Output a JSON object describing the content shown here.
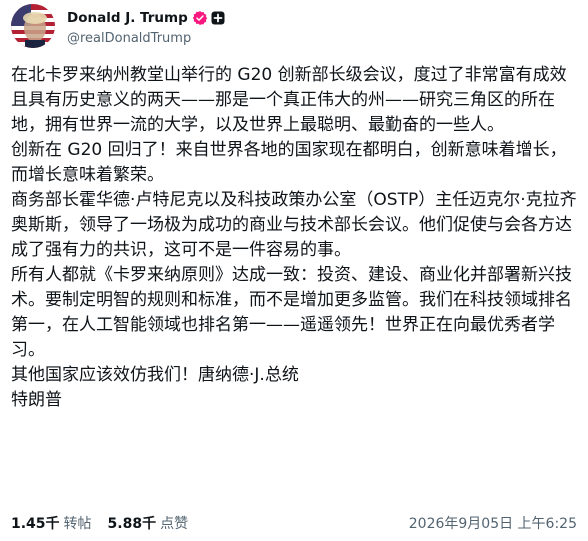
{
  "author": {
    "display_name": "Donald J. Trump",
    "handle": "@realDonaldTrump",
    "verified_color": "#f91880"
  },
  "post": {
    "paragraphs": [
      "在北卡罗来纳州教堂山举行的 G20 创新部长级会议，度过了非常富有成效且具有历史意义的两天——那是一个真正伟大的州——研究三角区的所在地，拥有世界一流的大学，以及世界上最聪明、最勤奋的一些人。",
      "创新在 G20 回归了！来自世界各地的国家现在都明白，创新意味着增长，而增长意味着繁荣。",
      "商务部长霍华德·卢特尼克以及科技政策办公室（OSTP）主任迈克尔·克拉齐奥斯斯，领导了一场极为成功的商业与技术部长会议。他们促使与会各方达成了强有力的共识，这可不是一件容易的事。",
      "所有人都就《卡罗来纳原则》达成一致：投资、建设、商业化并部署新兴技术。要制定明智的规则和标准，而不是增加更多监管。我们在科技领域排名第一，在人工智能领域也排名第一——遥遥领先！世界正在向最优秀者学习。",
      "其他国家应该效仿我们！唐纳德·J.总统",
      "特朗普"
    ]
  },
  "stats": {
    "reposts_count": "1.45千",
    "reposts_label": "转帖",
    "likes_count": "5.88千",
    "likes_label": "点赞",
    "timestamp": "2026年9月05日 上午6:25"
  }
}
